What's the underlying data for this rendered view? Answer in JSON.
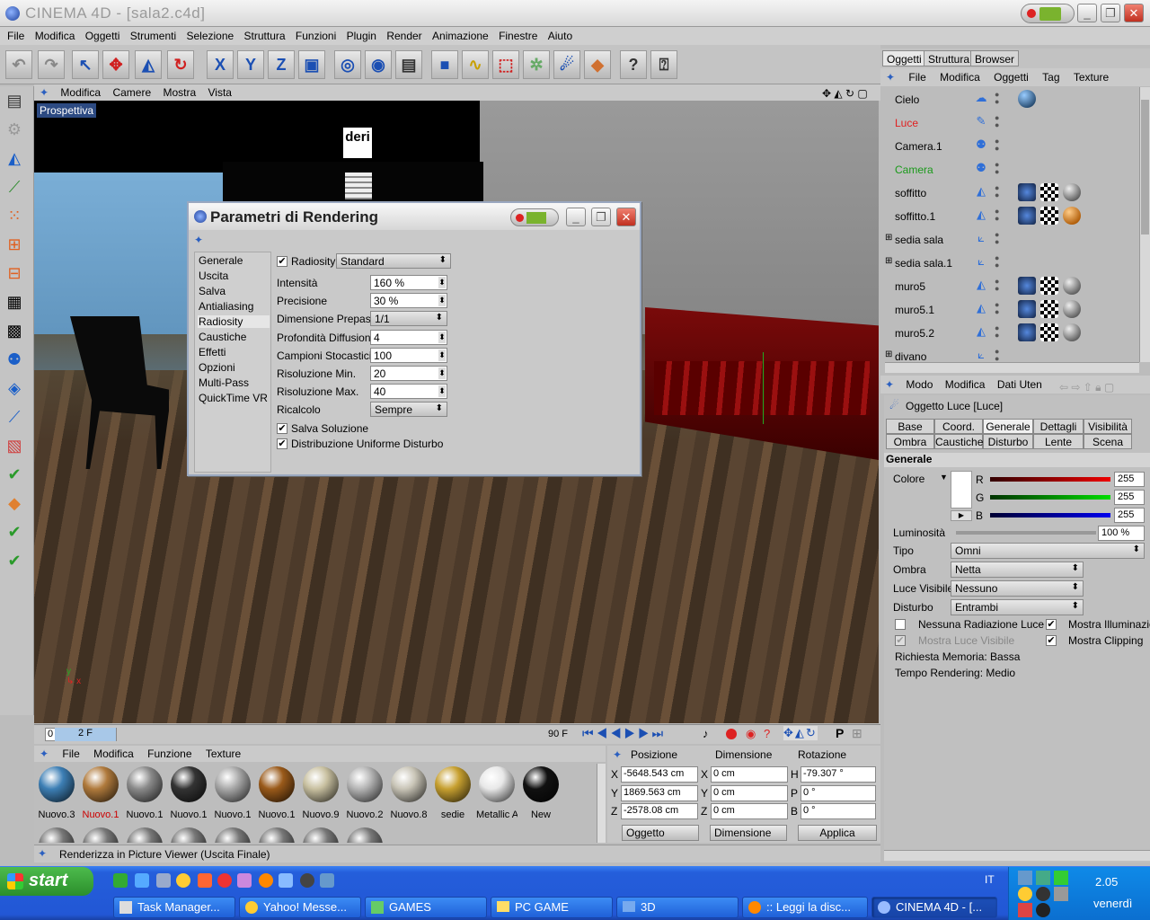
{
  "window": {
    "title": "CINEMA 4D - [sala2.c4d]"
  },
  "menubar": [
    "File",
    "Modifica",
    "Oggetti",
    "Strumenti",
    "Selezione",
    "Struttura",
    "Funzioni",
    "Plugin",
    "Render",
    "Animazione",
    "Finestre",
    "Aiuto"
  ],
  "viewport": {
    "menu": [
      "Modifica",
      "Camere",
      "Mostra",
      "Vista"
    ],
    "label": "Prospettiva",
    "sign_text": "deri"
  },
  "timeline": {
    "start": "0",
    "current": "2 F",
    "end": "90 F"
  },
  "dialog": {
    "title": "Parametri di Rendering",
    "sections": [
      "Generale",
      "Uscita",
      "Salva",
      "Antialiasing",
      "Radiosity",
      "Caustiche",
      "Effetti",
      "Opzioni",
      "Multi-Pass",
      "QuickTime VR"
    ],
    "active_section": "Radiosity",
    "radiosity_label": "Radiosity",
    "radiosity_mode": "Standard",
    "fields": [
      {
        "label": "Intensità",
        "value": "160 %"
      },
      {
        "label": "Precisione",
        "value": "30 %"
      },
      {
        "label": "Dimensione Prepass",
        "value": "1/1"
      },
      {
        "label": "Profondità Diffusione",
        "value": "4"
      },
      {
        "label": "Campioni Stocastici",
        "value": "100"
      },
      {
        "label": "Risoluzione Min.",
        "value": "20"
      },
      {
        "label": "Risoluzione Max.",
        "value": "40"
      },
      {
        "label": "Ricalcolo",
        "value": "Sempre"
      }
    ],
    "checks": [
      {
        "label": "Salva Soluzione",
        "checked": true
      },
      {
        "label": "Distribuzione Uniforme Disturbo",
        "checked": true
      }
    ]
  },
  "materials": {
    "menu": [
      "File",
      "Modifica",
      "Funzione",
      "Texture"
    ],
    "items": [
      {
        "name": "Nuovo.3",
        "color": "#3d7fb5"
      },
      {
        "name": "Nuovo.1",
        "color": "#b07a3c"
      },
      {
        "name": "Nuovo.1",
        "color": "#8a8a8a"
      },
      {
        "name": "Nuovo.1",
        "color": "#333333"
      },
      {
        "name": "Nuovo.1",
        "color": "#a9a9a9"
      },
      {
        "name": "Nuovo.1",
        "color": "#9a5a1a"
      },
      {
        "name": "Nuovo.9",
        "color": "#c8c0a0"
      },
      {
        "name": "Nuovo.2",
        "color": "#b5b5b5"
      },
      {
        "name": "Nuovo.8",
        "color": "#c8c4b6"
      },
      {
        "name": "sedie",
        "color": "#c7a030"
      },
      {
        "name": "Metallic A",
        "color": "#e8e8e8"
      },
      {
        "name": "New",
        "color": "#111111"
      }
    ]
  },
  "status": "Renderizza in Picture Viewer (Uscita Finale)",
  "coords": {
    "headers": [
      "Posizione",
      "Dimensione",
      "Rotazione"
    ],
    "rows": [
      {
        "axis": "X",
        "pos": "-5648.543 cm",
        "dim_axis": "X",
        "dim": "0 cm",
        "rot_axis": "H",
        "rot": "-79.307 °"
      },
      {
        "axis": "Y",
        "pos": "1869.563 cm",
        "dim_axis": "Y",
        "dim": "0 cm",
        "rot_axis": "P",
        "rot": "0 °"
      },
      {
        "axis": "Z",
        "pos": "-2578.08 cm",
        "dim_axis": "Z",
        "dim": "0 cm",
        "rot_axis": "B",
        "rot": "0 °"
      }
    ],
    "mode1": "Oggetto",
    "mode2": "Dimensione",
    "apply": "Applica"
  },
  "object_manager": {
    "tabs": [
      "Oggetti",
      "Struttura",
      "Browser"
    ],
    "menu": [
      "File",
      "Modifica",
      "Oggetti",
      "Tag",
      "Texture"
    ],
    "objects": [
      {
        "name": "Cielo",
        "color": "#000000",
        "expandable": false,
        "icon": "sky-icon",
        "tags": [
          "sphere"
        ]
      },
      {
        "name": "Luce",
        "color": "#e02020",
        "expandable": false,
        "icon": "light-icon",
        "tags": []
      },
      {
        "name": "Camera.1",
        "color": "#000000",
        "expandable": false,
        "icon": "camera-icon",
        "tags": []
      },
      {
        "name": "Camera",
        "color": "#1a9a1a",
        "expandable": false,
        "icon": "camera-icon",
        "tags": []
      },
      {
        "name": "soffitto",
        "color": "#000000",
        "expandable": false,
        "icon": "polygon-icon",
        "tags": [
          "blue",
          "check",
          "grey"
        ]
      },
      {
        "name": "soffitto.1",
        "color": "#000000",
        "expandable": false,
        "icon": "polygon-icon",
        "tags": [
          "blue",
          "check",
          "orange"
        ]
      },
      {
        "name": "sedia sala",
        "color": "#000000",
        "expandable": true,
        "icon": "null-icon",
        "tags": []
      },
      {
        "name": "sedia sala.1",
        "color": "#000000",
        "expandable": true,
        "icon": "null-icon",
        "tags": []
      },
      {
        "name": "muro5",
        "color": "#000000",
        "expandable": false,
        "icon": "polygon-icon",
        "tags": [
          "blue",
          "check",
          "grey"
        ]
      },
      {
        "name": "muro5.1",
        "color": "#000000",
        "expandable": false,
        "icon": "polygon-icon",
        "tags": [
          "blue",
          "check",
          "grey"
        ]
      },
      {
        "name": "muro5.2",
        "color": "#000000",
        "expandable": false,
        "icon": "polygon-icon",
        "tags": [
          "blue",
          "check",
          "grey"
        ]
      },
      {
        "name": "divano",
        "color": "#000000",
        "expandable": true,
        "icon": "null-icon",
        "tags": []
      }
    ]
  },
  "attributes": {
    "menu": [
      "Modo",
      "Modifica",
      "Dati Uten"
    ],
    "object_title": "Oggetto Luce [Luce]",
    "tabs_row1": [
      "Base",
      "Coord.",
      "Generale",
      "Dettagli",
      "Visibilità"
    ],
    "tabs_row2": [
      "Ombra",
      "Caustiche",
      "Disturbo",
      "Lente",
      "Scena"
    ],
    "active_tab": "Generale",
    "section": "Generale",
    "color_label": "Colore",
    "r": "255",
    "g": "255",
    "b": "255",
    "r_label": "R",
    "g_label": "G",
    "b_label": "B",
    "luminosity_label": "Luminosità",
    "luminosity": "100 %",
    "tipo_label": "Tipo",
    "tipo": "Omni",
    "ombra_label": "Ombra",
    "ombra": "Netta",
    "luce_visibile_label": "Luce Visibile",
    "luce_visibile": "Nessuno",
    "disturbo_label": "Disturbo",
    "disturbo": "Entrambi",
    "check1": "Nessuna Radiazione Luce",
    "check2": "Mostra Illuminazior",
    "check3": "Mostra Luce Visibile",
    "check4": "Mostra Clipping",
    "memory": "Richiesta Memoria: Bassa",
    "render_time": "Tempo Rendering: Medio"
  },
  "taskbar": {
    "start": "start",
    "tasks": [
      "Task Manager...",
      "Yahoo! Messe...",
      "GAMES",
      "PC GAME",
      "3D",
      ":: Leggi la disc...",
      "CINEMA 4D - [..."
    ],
    "active_task": "CINEMA 4D - [...",
    "clock": "2.05",
    "day": "venerdì",
    "lang": "IT"
  }
}
